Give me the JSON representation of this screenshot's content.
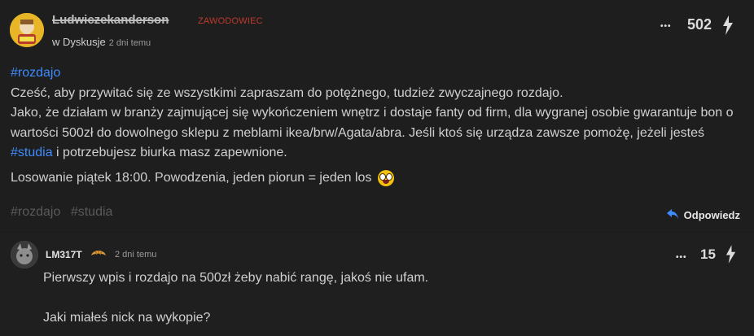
{
  "post": {
    "username": "Ludwiczekanderson",
    "rank": "ZAWODOWIEC",
    "location": "w Dyskusje",
    "time": "2 dni temu",
    "more_label": "•••",
    "votes": "502",
    "paragraphs": {
      "tag_line": "#rozdajo",
      "line1": "Cześć, aby przywitać się ze wszystkimi zapraszam do potężnego, tudzież zwyczajnego rozdajo.",
      "line2a": "Jako, że działam w branży zajmującej się wykończeniem wnętrz i dostaje fanty od firm, dla wygranej osobie gwarantuje bon o wartości 500zł do dowolnego sklepu z meblami ikea/brw/Agata/abra. Jeśli ktoś się urządza zawsze pomożę, jeżeli jesteś ",
      "line2_tag": "#studia",
      "line2b": " i potrzebujesz biurka masz zapewnione.",
      "lottery": "Losowanie piątek 18:00. Powodzenia, jeden piorun = jeden los"
    },
    "footer_tags": [
      "#rozdajo",
      "#studia"
    ],
    "reply_label": "Odpowiedz"
  },
  "comment": {
    "username": "LM317T",
    "time": "2 dni temu",
    "more_label": "•••",
    "votes": "15",
    "line1": "Pierwszy wpis i rozdajo na 500zł żeby nabić rangę, jakoś nie ufam.",
    "line2": "Jaki miałeś nick na wykopie?"
  },
  "colors": {
    "background": "#1e1e1f",
    "tag": "#3d8bfd",
    "rank": "#c0392b"
  },
  "icons": {
    "more": "ellipsis-icon",
    "vote": "lightning-icon",
    "reply": "reply-arrow-icon",
    "emoji": "grinning-face-emoji",
    "badge": "croissant-icon"
  }
}
